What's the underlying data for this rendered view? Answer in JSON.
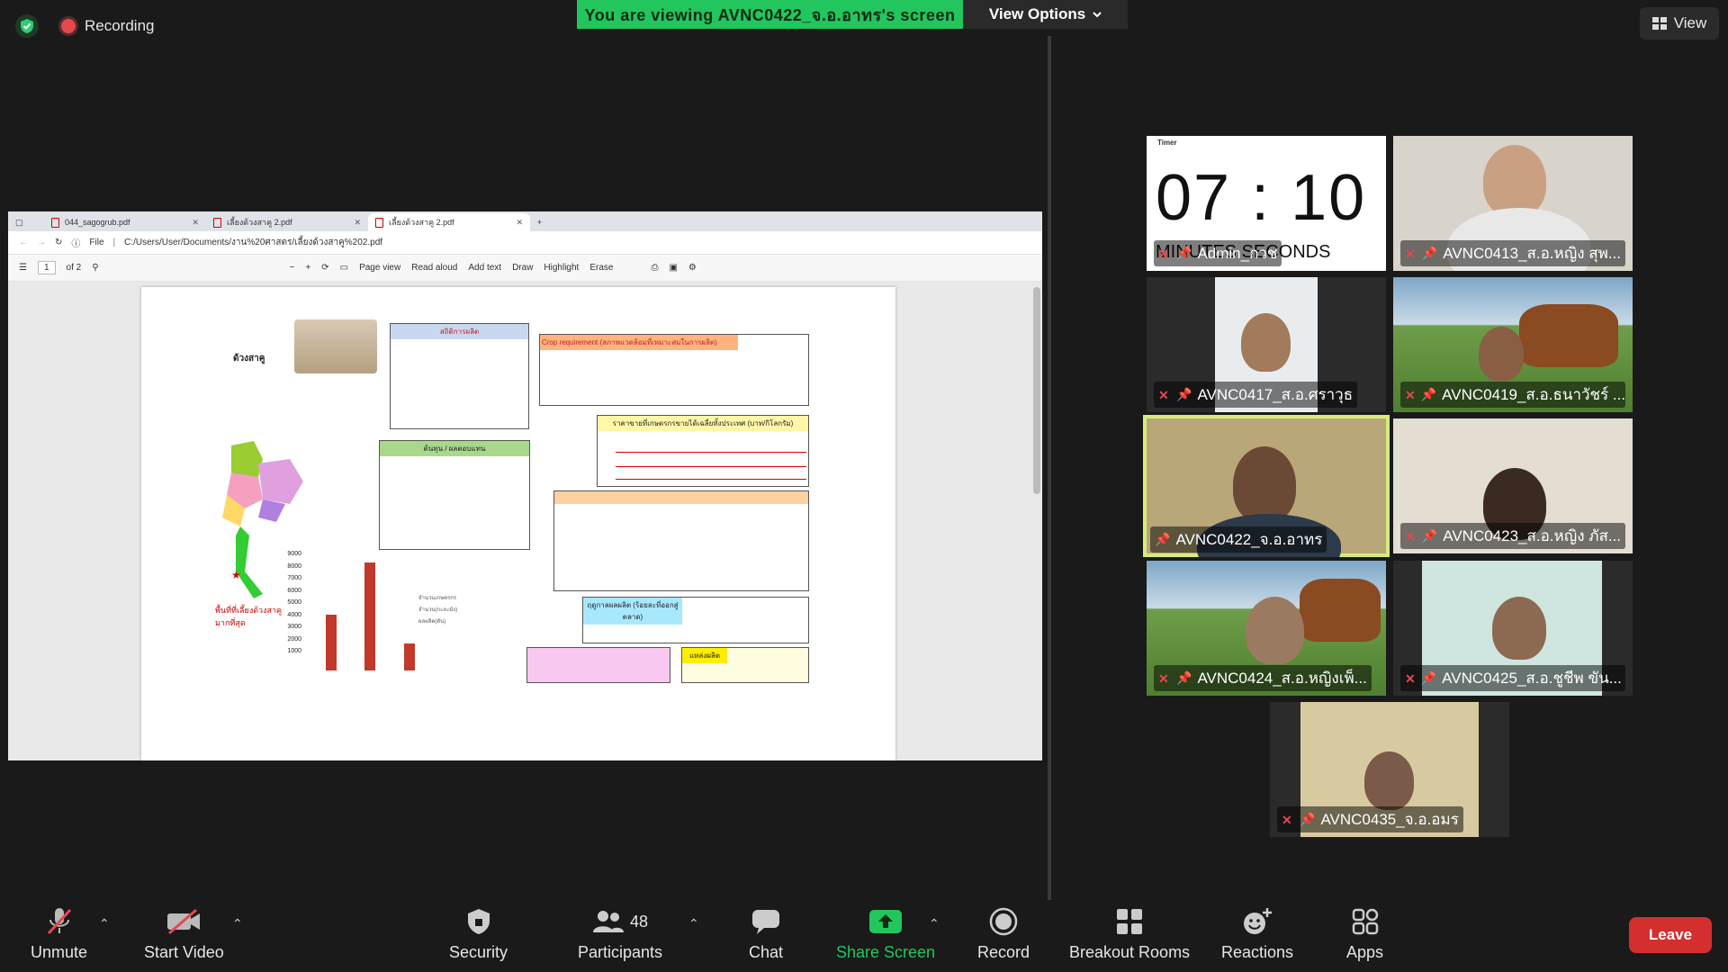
{
  "top": {
    "recording": "Recording",
    "banner": "You are viewing AVNC0422_จ.อ.อาทร's screen",
    "view_options": "View Options",
    "view": "View"
  },
  "browser": {
    "tabs": [
      "044_sagogrub.pdf",
      "เลี้ยงด้วงสาคู 2.pdf",
      "เลี้ยงด้วงสาคู 2.pdf"
    ],
    "file_label": "File",
    "url": "C:/Users/User/Documents/งาน%20ศาสตร/เลี้ยงด้วงสาคู%202.pdf",
    "page_current": "1",
    "page_total": "of 2",
    "tools": [
      "Page view",
      "Read aloud",
      "Add text",
      "Draw",
      "Highlight",
      "Erase"
    ]
  },
  "pdf": {
    "title": "ด้วงสาคู",
    "stats_header": "สถิติการผลิต",
    "crop_header": "Crop requirement (สภาพแวดล้อมที่เหมาะสมในการผลิต)",
    "cost_header": "ต้นทุน / ผลตอบแทน",
    "price_header": "ราคาขายที่เกษตรกรขายได้เฉลี่ยทั้งประเทศ (บาท/กิโลกรัม)",
    "region_header": "แหล่งผลิต",
    "season_header": "ฤดูกาลผลผลิต (ร้อยละที่ออกสู่ตลาด)",
    "legend": [
      "จำนวนเกษตรกร",
      "จำนวน(กะละมัง)",
      "ผลผลิต(ตัน)"
    ],
    "map_note": "พื้นที่ที่เลี้ยงด้วงสาคูมากที่สุด",
    "y_ticks": [
      "9000",
      "8000",
      "7000",
      "6000",
      "5000",
      "4000",
      "3000",
      "2000",
      "1000"
    ]
  },
  "timer": {
    "label": "Timer",
    "time": "07 : 10",
    "units": "MINUTES   SECONDS"
  },
  "participants": [
    "Admin_กวช",
    "AVNC0413_ส.อ.หญิง สุพ...",
    "AVNC0417_ส.อ.ศราวุธ",
    "AVNC0419_ส.อ.ธนาวัชร์ ...",
    "AVNC0422_จ.อ.อาทร",
    "AVNC0423_ส.อ.หญิง ภัส...",
    "AVNC0424_ส.อ.หญิงเพ็...",
    "AVNC0425_ส.อ.ชูชีพ ขัน...",
    "AVNC0435_จ.อ.อมร"
  ],
  "toolbar": {
    "unmute": "Unmute",
    "start_video": "Start Video",
    "security": "Security",
    "participants": "Participants",
    "participants_count": "48",
    "chat": "Chat",
    "share_screen": "Share Screen",
    "record": "Record",
    "breakout": "Breakout Rooms",
    "reactions": "Reactions",
    "apps": "Apps",
    "leave": "Leave"
  },
  "colors": {
    "accent_green": "#23c55e",
    "leave_red": "#d32f2f",
    "active_speaker": "#d7ec7a"
  }
}
